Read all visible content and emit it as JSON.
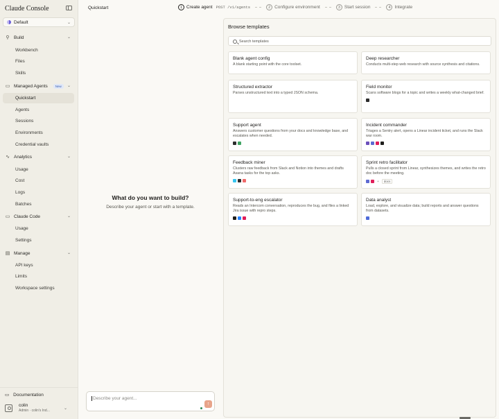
{
  "app": {
    "brand": "Claude Console"
  },
  "workspace": {
    "name": "Default"
  },
  "sidebar": {
    "sections": [
      {
        "key": "build",
        "label": "Build",
        "items": [
          "Workbench",
          "Files",
          "Skills"
        ]
      },
      {
        "key": "managed_agents",
        "label": "Managed Agents",
        "badge": "New",
        "items": [
          "Quickstart",
          "Agents",
          "Sessions",
          "Environments",
          "Credential vaults"
        ],
        "active": "Quickstart"
      },
      {
        "key": "analytics",
        "label": "Analytics",
        "items": [
          "Usage",
          "Cost",
          "Logs",
          "Batches"
        ]
      },
      {
        "key": "claude_code",
        "label": "Claude Code",
        "items": [
          "Usage",
          "Settings"
        ]
      },
      {
        "key": "manage",
        "label": "Manage",
        "items": [
          "API keys",
          "Limits",
          "Workspace settings"
        ]
      }
    ],
    "documentation": "Documentation",
    "user": {
      "name": "colin",
      "role": "Admin · colin's Ind..."
    }
  },
  "topbar": {
    "title": "Quickstart",
    "steps": [
      {
        "num": "1",
        "label": "Create agent",
        "code": "POST /v1/agents",
        "active": true
      },
      {
        "num": "2",
        "label": "Configure environment"
      },
      {
        "num": "3",
        "label": "Start session"
      },
      {
        "num": "4",
        "label": "Integrate"
      }
    ]
  },
  "center": {
    "title": "What do you want to build?",
    "subtitle": "Describe your agent or start with a template.",
    "prompt_placeholder": "Describe your agent..."
  },
  "templates": {
    "title": "Browse templates",
    "search_placeholder": "Search templates",
    "cards": [
      {
        "title": "Blank agent config",
        "desc": "A blank starting point with the core toolset.",
        "icons": []
      },
      {
        "title": "Deep researcher",
        "desc": "Conducts multi-step web research with source synthesis and citations.",
        "icons": []
      },
      {
        "title": "Structured extractor",
        "desc": "Parses unstructured text into a typed JSON schema.",
        "icons": []
      },
      {
        "title": "Field monitor",
        "desc": "Scans software blogs for a topic and writes a weekly what-changed brief.",
        "icons": [
          "#2d2d2d"
        ]
      },
      {
        "title": "Support agent",
        "desc": "Answers customer questions from your docs and knowledge base, and escalates when needed.",
        "icons": [
          "#2d2d2d",
          "#3fa463"
        ]
      },
      {
        "title": "Incident commander",
        "desc": "Triages a Sentry alert, opens a Linear incident ticket, and runs the Slack war room.",
        "icons": [
          "#6b4fbb",
          "#5e6ad2",
          "#e01e5a",
          "#1f1e1c"
        ]
      },
      {
        "title": "Feedback miner",
        "desc": "Clusters raw feedback from Slack and Notion into themes and drafts Asana tasks for the top asks.",
        "icons": [
          "#36c5f0",
          "#2d2d2d",
          "#f06a6a"
        ]
      },
      {
        "title": "Sprint retro facilitator",
        "desc": "Pulls a closed sprint from Linear, synthesizes themes, and writes the retro doc before the meeting.",
        "icons": [
          "#5e6ad2",
          "#e01e5a"
        ],
        "extra": "docs"
      },
      {
        "title": "Support-to-eng escalator",
        "desc": "Reads an Intercom conversation, reproduces the bug, and files a linked Jira issue with repro steps.",
        "icons": [
          "#1f1e1c",
          "#2684ff",
          "#e01e5a"
        ]
      },
      {
        "title": "Data analyst",
        "desc": "Load, explore, and visualize data; build reports and answer questions from datasets.",
        "icons": [
          "#4f6bd9"
        ]
      }
    ]
  }
}
